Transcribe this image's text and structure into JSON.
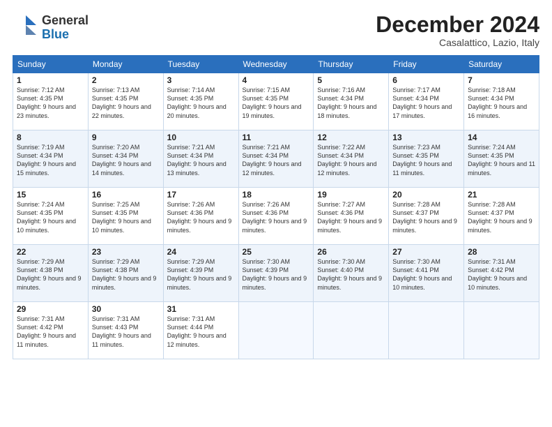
{
  "logo": {
    "general": "General",
    "blue": "Blue"
  },
  "header": {
    "month": "December 2024",
    "location": "Casalattico, Lazio, Italy"
  },
  "days_of_week": [
    "Sunday",
    "Monday",
    "Tuesday",
    "Wednesday",
    "Thursday",
    "Friday",
    "Saturday"
  ],
  "weeks": [
    [
      {
        "day": "1",
        "sunrise": "7:12 AM",
        "sunset": "4:35 PM",
        "daylight": "9 hours and 23 minutes."
      },
      {
        "day": "2",
        "sunrise": "7:13 AM",
        "sunset": "4:35 PM",
        "daylight": "9 hours and 22 minutes."
      },
      {
        "day": "3",
        "sunrise": "7:14 AM",
        "sunset": "4:35 PM",
        "daylight": "9 hours and 20 minutes."
      },
      {
        "day": "4",
        "sunrise": "7:15 AM",
        "sunset": "4:35 PM",
        "daylight": "9 hours and 19 minutes."
      },
      {
        "day": "5",
        "sunrise": "7:16 AM",
        "sunset": "4:34 PM",
        "daylight": "9 hours and 18 minutes."
      },
      {
        "day": "6",
        "sunrise": "7:17 AM",
        "sunset": "4:34 PM",
        "daylight": "9 hours and 17 minutes."
      },
      {
        "day": "7",
        "sunrise": "7:18 AM",
        "sunset": "4:34 PM",
        "daylight": "9 hours and 16 minutes."
      }
    ],
    [
      {
        "day": "8",
        "sunrise": "7:19 AM",
        "sunset": "4:34 PM",
        "daylight": "9 hours and 15 minutes."
      },
      {
        "day": "9",
        "sunrise": "7:20 AM",
        "sunset": "4:34 PM",
        "daylight": "9 hours and 14 minutes."
      },
      {
        "day": "10",
        "sunrise": "7:21 AM",
        "sunset": "4:34 PM",
        "daylight": "9 hours and 13 minutes."
      },
      {
        "day": "11",
        "sunrise": "7:21 AM",
        "sunset": "4:34 PM",
        "daylight": "9 hours and 12 minutes."
      },
      {
        "day": "12",
        "sunrise": "7:22 AM",
        "sunset": "4:34 PM",
        "daylight": "9 hours and 12 minutes."
      },
      {
        "day": "13",
        "sunrise": "7:23 AM",
        "sunset": "4:35 PM",
        "daylight": "9 hours and 11 minutes."
      },
      {
        "day": "14",
        "sunrise": "7:24 AM",
        "sunset": "4:35 PM",
        "daylight": "9 hours and 11 minutes."
      }
    ],
    [
      {
        "day": "15",
        "sunrise": "7:24 AM",
        "sunset": "4:35 PM",
        "daylight": "9 hours and 10 minutes."
      },
      {
        "day": "16",
        "sunrise": "7:25 AM",
        "sunset": "4:35 PM",
        "daylight": "9 hours and 10 minutes."
      },
      {
        "day": "17",
        "sunrise": "7:26 AM",
        "sunset": "4:36 PM",
        "daylight": "9 hours and 9 minutes."
      },
      {
        "day": "18",
        "sunrise": "7:26 AM",
        "sunset": "4:36 PM",
        "daylight": "9 hours and 9 minutes."
      },
      {
        "day": "19",
        "sunrise": "7:27 AM",
        "sunset": "4:36 PM",
        "daylight": "9 hours and 9 minutes."
      },
      {
        "day": "20",
        "sunrise": "7:28 AM",
        "sunset": "4:37 PM",
        "daylight": "9 hours and 9 minutes."
      },
      {
        "day": "21",
        "sunrise": "7:28 AM",
        "sunset": "4:37 PM",
        "daylight": "9 hours and 9 minutes."
      }
    ],
    [
      {
        "day": "22",
        "sunrise": "7:29 AM",
        "sunset": "4:38 PM",
        "daylight": "9 hours and 9 minutes."
      },
      {
        "day": "23",
        "sunrise": "7:29 AM",
        "sunset": "4:38 PM",
        "daylight": "9 hours and 9 minutes."
      },
      {
        "day": "24",
        "sunrise": "7:29 AM",
        "sunset": "4:39 PM",
        "daylight": "9 hours and 9 minutes."
      },
      {
        "day": "25",
        "sunrise": "7:30 AM",
        "sunset": "4:39 PM",
        "daylight": "9 hours and 9 minutes."
      },
      {
        "day": "26",
        "sunrise": "7:30 AM",
        "sunset": "4:40 PM",
        "daylight": "9 hours and 9 minutes."
      },
      {
        "day": "27",
        "sunrise": "7:30 AM",
        "sunset": "4:41 PM",
        "daylight": "9 hours and 10 minutes."
      },
      {
        "day": "28",
        "sunrise": "7:31 AM",
        "sunset": "4:42 PM",
        "daylight": "9 hours and 10 minutes."
      }
    ],
    [
      {
        "day": "29",
        "sunrise": "7:31 AM",
        "sunset": "4:42 PM",
        "daylight": "9 hours and 11 minutes."
      },
      {
        "day": "30",
        "sunrise": "7:31 AM",
        "sunset": "4:43 PM",
        "daylight": "9 hours and 11 minutes."
      },
      {
        "day": "31",
        "sunrise": "7:31 AM",
        "sunset": "4:44 PM",
        "daylight": "9 hours and 12 minutes."
      },
      null,
      null,
      null,
      null
    ]
  ]
}
